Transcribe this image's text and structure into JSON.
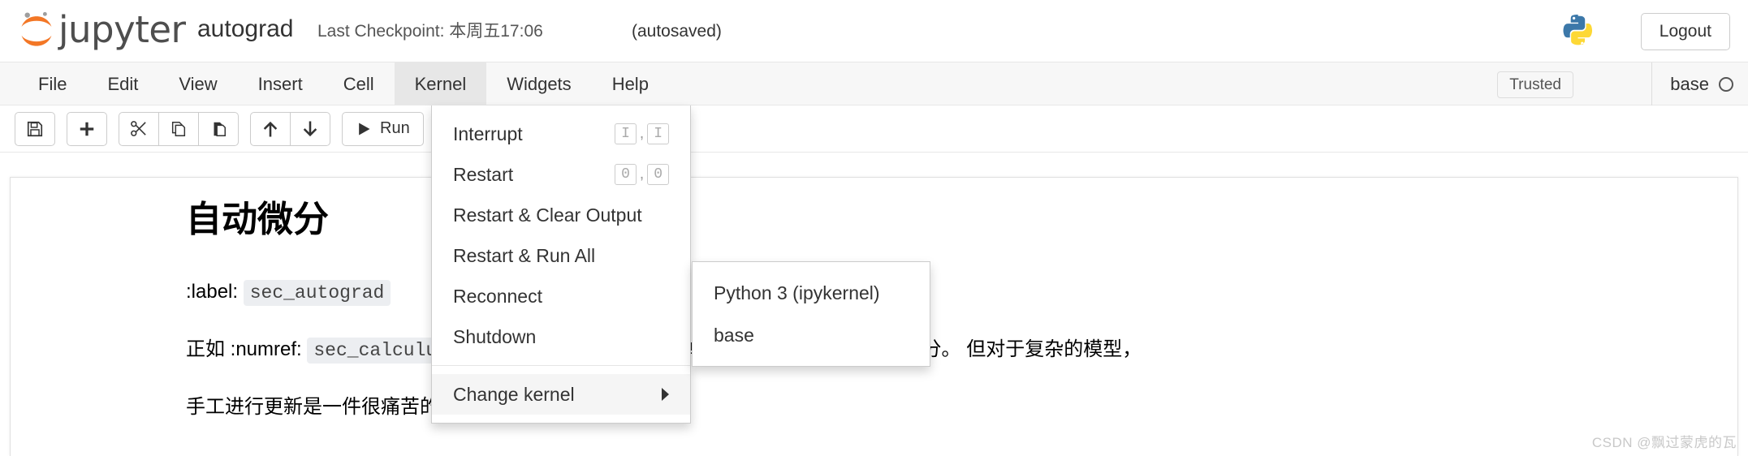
{
  "header": {
    "brand": "jupyter",
    "notebook_name": "autograd",
    "checkpoint": "Last Checkpoint: 本周五17:06",
    "autosaved": "(autosaved)",
    "logout_label": "Logout",
    "logo_icon": "jupyter-logo-icon",
    "python_icon": "python-logo-icon",
    "brand_color": "#f37726"
  },
  "menubar": {
    "items": [
      {
        "label": "File",
        "active": false
      },
      {
        "label": "Edit",
        "active": false
      },
      {
        "label": "View",
        "active": false
      },
      {
        "label": "Insert",
        "active": false
      },
      {
        "label": "Cell",
        "active": false
      },
      {
        "label": "Kernel",
        "active": true
      },
      {
        "label": "Widgets",
        "active": false
      },
      {
        "label": "Help",
        "active": false
      }
    ],
    "trusted_label": "Trusted",
    "kernel_name": "base"
  },
  "toolbar": {
    "buttons": [
      {
        "name": "save-button",
        "icon": "floppy-disk-icon",
        "glyph": "💾",
        "title": "Save and Checkpoint"
      },
      {
        "name": "insert-cell-button",
        "icon": "plus-icon",
        "glyph": "➕",
        "title": "Insert cell below"
      },
      {
        "name": "cut-cell-button",
        "icon": "scissors-icon",
        "glyph": "✂",
        "title": "Cut cells"
      },
      {
        "name": "copy-cell-button",
        "icon": "copy-icon",
        "glyph": "⧉",
        "title": "Copy cells"
      },
      {
        "name": "paste-cell-button",
        "icon": "clipboard-icon",
        "glyph": "📋",
        "title": "Paste cells below"
      },
      {
        "name": "move-cell-up-button",
        "icon": "arrow-up-icon",
        "glyph": "↑",
        "title": "Move cell up"
      },
      {
        "name": "move-cell-down-button",
        "icon": "arrow-down-icon",
        "glyph": "↓",
        "title": "Move cell down"
      }
    ],
    "run_label": "Run",
    "run_icon": "play-icon",
    "cell_type_value": "",
    "keyboard_icon": "keyboard-icon",
    "command_palette_icon": "chart-bar-icon"
  },
  "kernel_menu": {
    "items": [
      {
        "label": "Interrupt",
        "shortcut": [
          "I",
          "I"
        ],
        "submenu": false,
        "highlight": false
      },
      {
        "label": "Restart",
        "shortcut": [
          "0",
          "0"
        ],
        "submenu": false,
        "highlight": false
      },
      {
        "label": "Restart & Clear Output",
        "shortcut": [],
        "submenu": false,
        "highlight": false
      },
      {
        "label": "Restart & Run All",
        "shortcut": [],
        "submenu": false,
        "highlight": false
      },
      {
        "label": "Reconnect",
        "shortcut": [],
        "submenu": false,
        "highlight": false
      },
      {
        "label": "Shutdown",
        "shortcut": [],
        "submenu": false,
        "highlight": false
      }
    ],
    "change_kernel": {
      "label": "Change kernel",
      "highlight": true,
      "options": [
        {
          "label": "Python 3 (ipykernel)"
        },
        {
          "label": "base"
        }
      ]
    }
  },
  "notebook": {
    "heading": "自动微分",
    "label_prefix": ":label:",
    "label_value": "sec_autograd",
    "paragraph_line1_pre": "正如 :numref:",
    "paragraph_line1_code": "sec_calculu",
    "paragraph_line1_post": "步骤。 虽然求导的计算很简单，只需要一些基本的微积分。 但对于复杂的模型，",
    "paragraph_line2": "手工进行更新是一件很痛苦的事情（而且经常容易出错",
    "watermark": "CSDN @飘过蒙虎的瓦"
  }
}
